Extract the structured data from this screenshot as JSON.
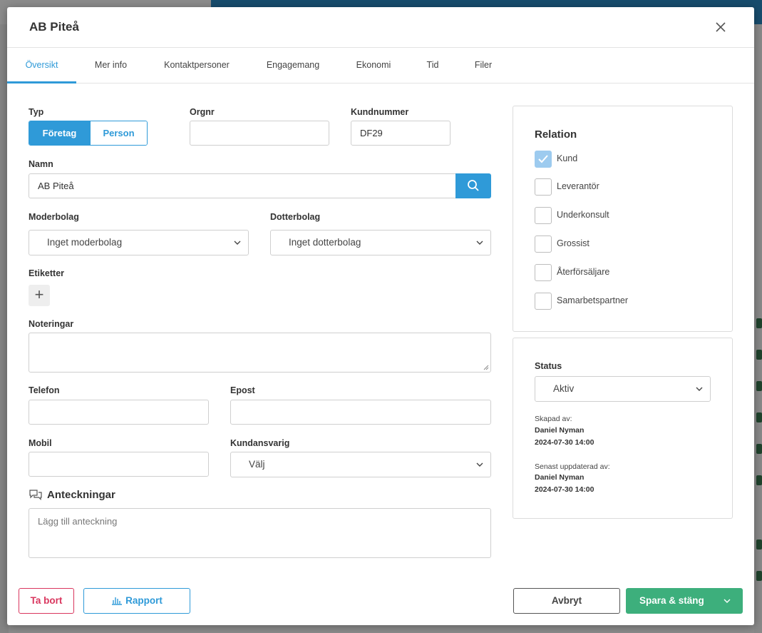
{
  "modal": {
    "title": "AB Piteå",
    "close_icon": "close-icon"
  },
  "tabs": [
    {
      "label": "Översikt",
      "active": true
    },
    {
      "label": "Mer info"
    },
    {
      "label": "Kontaktpersoner"
    },
    {
      "label": "Engagemang"
    },
    {
      "label": "Ekonomi"
    },
    {
      "label": "Tid"
    },
    {
      "label": "Filer"
    }
  ],
  "form": {
    "typ_label": "Typ",
    "typ_options": [
      "Företag",
      "Person"
    ],
    "typ_selected": "Företag",
    "orgnr_label": "Orgnr",
    "orgnr_value": "",
    "kundnummer_label": "Kundnummer",
    "kundnummer_value": "DF29",
    "namn_label": "Namn",
    "namn_value": "AB Piteå",
    "moderbolag_label": "Moderbolag",
    "moderbolag_value": "Inget moderbolag",
    "dotterbolag_label": "Dotterbolag",
    "dotterbolag_value": "Inget dotterbolag",
    "etiketter_label": "Etiketter",
    "noteringar_label": "Noteringar",
    "telefon_label": "Telefon",
    "epost_label": "Epost",
    "mobil_label": "Mobil",
    "kundansvarig_label": "Kundansvarig",
    "kundansvarig_value": "Välj",
    "anteckningar_label": "Anteckningar",
    "anteckning_placeholder": "Lägg till anteckning"
  },
  "relation": {
    "title": "Relation",
    "items": [
      {
        "label": "Kund",
        "checked": true
      },
      {
        "label": "Leverantör",
        "checked": false
      },
      {
        "label": "Underkonsult",
        "checked": false
      },
      {
        "label": "Grossist",
        "checked": false
      },
      {
        "label": "Återförsäljare",
        "checked": false
      },
      {
        "label": "Samarbetspartner",
        "checked": false
      }
    ]
  },
  "status": {
    "label": "Status",
    "value": "Aktiv",
    "created_by_label": "Skapad av:",
    "created_by": "Daniel Nyman",
    "created_at": "2024-07-30 14:00",
    "updated_by_label": "Senast uppdaterad av:",
    "updated_by": "Daniel Nyman",
    "updated_at": "2024-07-30 14:00"
  },
  "footer": {
    "delete_label": "Ta bort",
    "report_label": "Rapport",
    "cancel_label": "Avbryt",
    "save_label": "Spara & stäng"
  },
  "colors": {
    "primary": "#2f9ad8",
    "success": "#3daf7c",
    "danger": "#d9365e"
  }
}
